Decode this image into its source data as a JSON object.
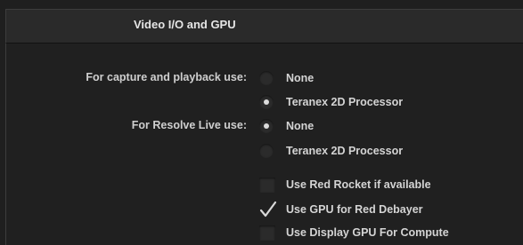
{
  "header": {
    "title": "Video I/O and GPU"
  },
  "capture_playback": {
    "label": "For capture and playback use:",
    "options": [
      {
        "label": "None",
        "selected": false
      },
      {
        "label": "Teranex 2D Processor",
        "selected": true
      }
    ]
  },
  "resolve_live": {
    "label": "For Resolve Live use:",
    "options": [
      {
        "label": "None",
        "selected": true
      },
      {
        "label": "Teranex 2D Processor",
        "selected": false
      }
    ]
  },
  "checkboxes": [
    {
      "label": "Use Red Rocket if available",
      "checked": false
    },
    {
      "label": "Use GPU for Red Debayer",
      "checked": true
    },
    {
      "label": "Use Display GPU For Compute",
      "checked": false
    }
  ],
  "colors": {
    "background": "#1f1f1f",
    "header_bg": "#2a2a2a",
    "text": "#d4d4d4"
  }
}
